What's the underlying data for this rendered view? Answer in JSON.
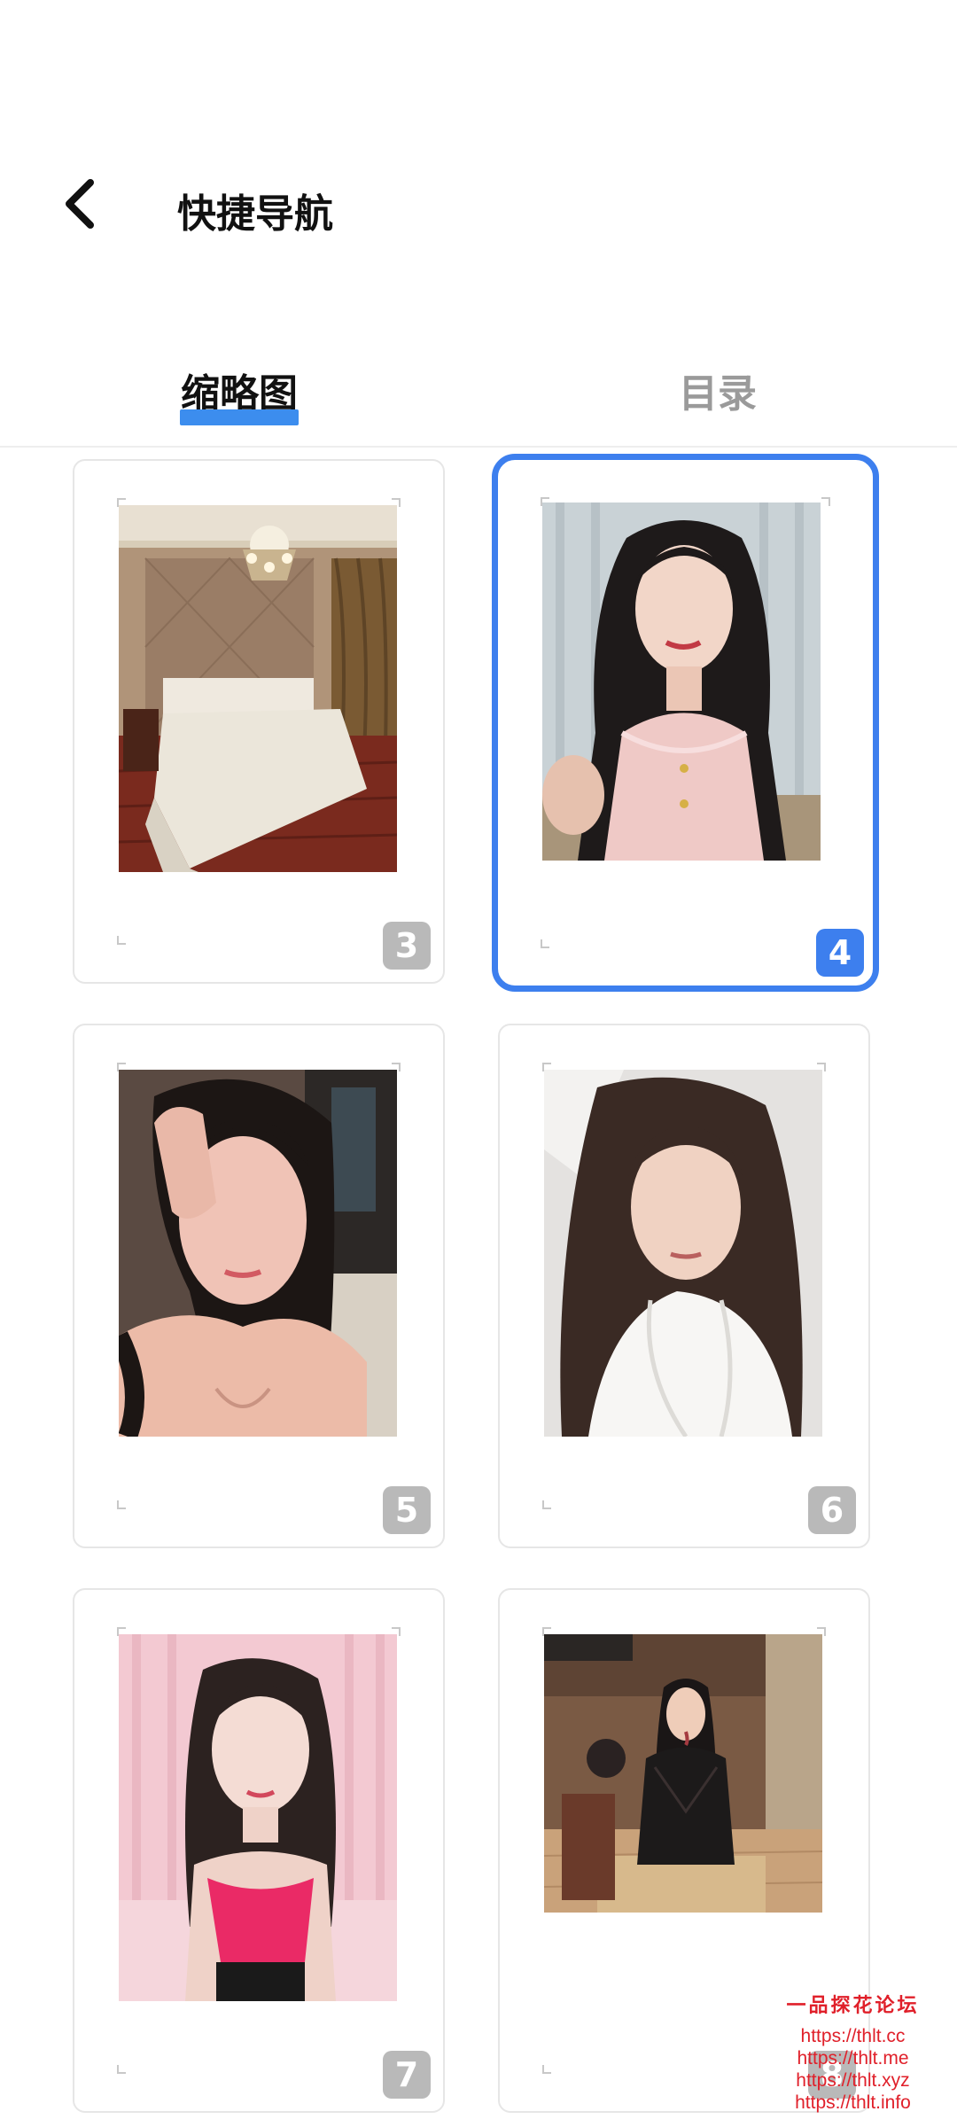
{
  "header": {
    "title": "快捷导航"
  },
  "tabs": [
    {
      "label": "缩略图",
      "active": true
    },
    {
      "label": "目录",
      "active": false
    }
  ],
  "thumbnails": [
    {
      "page": "3",
      "description": "bedroom",
      "selected": false
    },
    {
      "page": "4",
      "description": "portrait-pink-top",
      "selected": true
    },
    {
      "page": "5",
      "description": "portrait-hand-on-head",
      "selected": false
    },
    {
      "page": "6",
      "description": "portrait-white-towel",
      "selected": false
    },
    {
      "page": "7",
      "description": "portrait-pink-tank",
      "selected": false
    },
    {
      "page": "8",
      "description": "portrait-black-lace",
      "selected": false
    }
  ],
  "watermark": {
    "title": "一品探花论坛",
    "urls": [
      "https://thlt.cc",
      "https://thlt.me",
      "https://thlt.xyz",
      "https://thlt.info"
    ]
  },
  "colors": {
    "accent": "#3d7fee",
    "tab_inactive": "#9a9a9a",
    "badge_gray": "#b9b9b9",
    "watermark_red": "#e0202a"
  }
}
